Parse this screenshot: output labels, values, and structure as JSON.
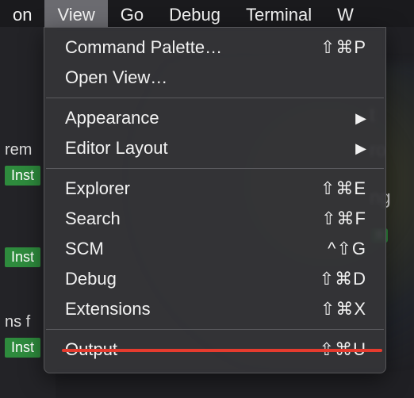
{
  "menubar": {
    "items": [
      {
        "label": "on",
        "active": false
      },
      {
        "label": "View",
        "active": true
      },
      {
        "label": "Go",
        "active": false
      },
      {
        "label": "Debug",
        "active": false
      },
      {
        "label": "Terminal",
        "active": false
      },
      {
        "label": "W",
        "active": false
      }
    ]
  },
  "dropdown": {
    "groups": [
      [
        {
          "label": "Command Palette…",
          "shortcut": "⇧⌘P",
          "submenu": false
        },
        {
          "label": "Open View…",
          "shortcut": "",
          "submenu": false
        }
      ],
      [
        {
          "label": "Appearance",
          "shortcut": "",
          "submenu": true
        },
        {
          "label": "Editor Layout",
          "shortcut": "",
          "submenu": true
        }
      ],
      [
        {
          "label": "Explorer",
          "shortcut": "⇧⌘E",
          "submenu": false
        },
        {
          "label": "Search",
          "shortcut": "⇧⌘F",
          "submenu": false
        },
        {
          "label": "SCM",
          "shortcut": "^⇧G",
          "submenu": false
        },
        {
          "label": "Debug",
          "shortcut": "⇧⌘D",
          "submenu": false
        },
        {
          "label": "Extensions",
          "shortcut": "⇧⌘X",
          "submenu": false
        }
      ],
      [
        {
          "label": "Output",
          "shortcut": "⇧⌘U",
          "submenu": false
        }
      ]
    ]
  },
  "sidebar_fragments": {
    "frag0": "on",
    "frag1": "rem",
    "badge0": "Inst",
    "badge1": "Inst",
    "frag2": "ns f",
    "badge2": "Inst"
  },
  "right_fragments": {
    "r0": "t",
    "r1": "ro",
    "r2": "ng",
    "badge": "II"
  }
}
